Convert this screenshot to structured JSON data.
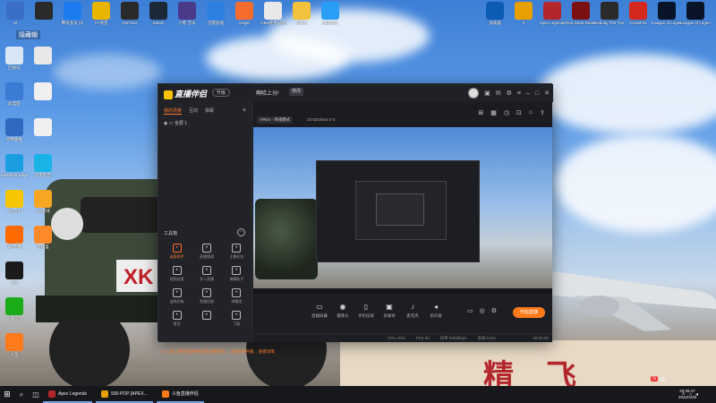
{
  "desktop": {
    "top_icons": [
      {
        "label": "Sl",
        "color": "#3a6ec7"
      },
      {
        "label": "",
        "color": "#2a2a2a"
      },
      {
        "label": "腾讯会议 (2)",
        "color": "#1a7cf0"
      },
      {
        "label": "YY语音",
        "color": "#e8b400"
      },
      {
        "label": "GeForce",
        "color": "#2a2a2a"
      },
      {
        "label": "Steam",
        "color": "#1b2838"
      },
      {
        "label": "小熊 音乐",
        "color": "#4b3a8a"
      },
      {
        "label": "迅雷加速",
        "color": "#2d7fe0"
      },
      {
        "label": "Origin",
        "color": "#f56c2d"
      },
      {
        "label": "OBS使用说明",
        "color": "#e8e8e8"
      },
      {
        "label": "Office",
        "color": "#f2c23c"
      },
      {
        "label": "腾讯QQ",
        "color": "#2a9df4"
      }
    ],
    "top_right_icons": [
      {
        "label": "加速器",
        "color": "#0c5bb5"
      },
      {
        "label": "V",
        "color": "#e8a000"
      },
      {
        "label": "Apex Legends",
        "color": "#b3262c"
      },
      {
        "label": "Red Dead Redemption",
        "color": "#7a1010"
      },
      {
        "label": "Nobody The Turnaround",
        "color": "#2a2a2a"
      },
      {
        "label": "CrossFire",
        "color": "#d4281c"
      },
      {
        "label": "League of Legends",
        "color": "#0a1428"
      },
      {
        "label": "League of Legends",
        "color": "#0a1428"
      }
    ],
    "left_icons": [
      {
        "label": "回收站",
        "color": "#d9e6f5"
      },
      {
        "label": "此电脑",
        "color": "#3a7bd5"
      },
      {
        "label": "控制面板",
        "color": "#2f6ac2"
      },
      {
        "label": "Microsoft Edge",
        "color": "#1b9de2"
      },
      {
        "label": "QQ音乐",
        "color": "#f7c600"
      },
      {
        "label": "XX直播",
        "color": "#ff6a00"
      },
      {
        "label": "QQ",
        "color": "#1a1a1a"
      },
      {
        "label": "微信",
        "color": "#1aad19"
      },
      {
        "label": "斗鱼",
        "color": "#ff7a1a"
      }
    ],
    "left_col2_icons": [
      {
        "label": "",
        "color": "#e8e8e8"
      },
      {
        "label": "",
        "color": "#f0f0f0"
      },
      {
        "label": "",
        "color": "#f0f0f0"
      },
      {
        "label": "迅雷影音",
        "color": "#19b3e6"
      },
      {
        "label": "QQ游戏",
        "color": "#f5a623"
      },
      {
        "label": "游戏盒",
        "color": "#ff8a2a"
      }
    ],
    "top_left_overlay_text": "隐藏帽"
  },
  "app": {
    "logo_text": "直播伴侣",
    "vip_badge": "升级",
    "live_title": "啊哈上分!",
    "title_tag": "修改",
    "sidebar_tabs": [
      "我的场景",
      "互动",
      "弹幕"
    ],
    "scene_label": "全屏 1",
    "game_pill": "APEX - 单排模式",
    "stats_text": "23   6202644   0   0",
    "tools_header": "工具箱",
    "tools": [
      {
        "label": "录屏助手",
        "icon": "record-icon",
        "hot": true
      },
      {
        "label": "直播管理",
        "icon": "manage-icon",
        "hot": false
      },
      {
        "label": "主播任务",
        "icon": "task-icon",
        "hot": false
      },
      {
        "label": "视频连麦",
        "icon": "video-link-icon",
        "hot": false
      },
      {
        "label": "多人直播",
        "icon": "multi-icon",
        "hot": false
      },
      {
        "label": "弹幕助手",
        "icon": "danmu-icon",
        "hot": false
      },
      {
        "label": "虚拟形象",
        "icon": "avatar-icon",
        "hot": false
      },
      {
        "label": "直播回放",
        "icon": "replay-icon",
        "hot": false
      },
      {
        "label": "弹幕墙",
        "icon": "wall-icon",
        "hot": false
      },
      {
        "label": "更多",
        "icon": "more-icon",
        "hot": false
      },
      {
        "label": "",
        "icon": "new-icon",
        "hot": false
      },
      {
        "label": "下载",
        "icon": "download-icon",
        "hot": false
      }
    ],
    "notice_text": "⊙ 公告: 请勿在直播中出现违规内容，以免影响开播…   查看详情",
    "controls": [
      {
        "label": "直播屏幕",
        "icon": "screen-icon"
      },
      {
        "label": "摄像头",
        "icon": "camera-icon"
      },
      {
        "label": "手机投屏",
        "icon": "phone-cast-icon"
      },
      {
        "label": "多媒体",
        "icon": "media-icon"
      },
      {
        "label": "麦克风",
        "icon": "mic-icon"
      },
      {
        "label": "扬声器",
        "icon": "speaker-icon"
      }
    ],
    "go_live_label": "开始直播",
    "status_items": [
      "CPU 40%",
      "FPS 60",
      "码率 5000kbps",
      "丢帧 0.0%"
    ],
    "live_time": "00:00:00"
  },
  "taskbar": {
    "tasks": [
      {
        "label": "Apex Legends",
        "color": "#b3262c"
      },
      {
        "label": "930-POP [APEX...",
        "color": "#e8a000"
      },
      {
        "label": "斗鱼直播伴侣",
        "color": "#ff7a1a"
      }
    ],
    "time": "20:06:47",
    "date": "2022/4/29",
    "ime": "中"
  }
}
